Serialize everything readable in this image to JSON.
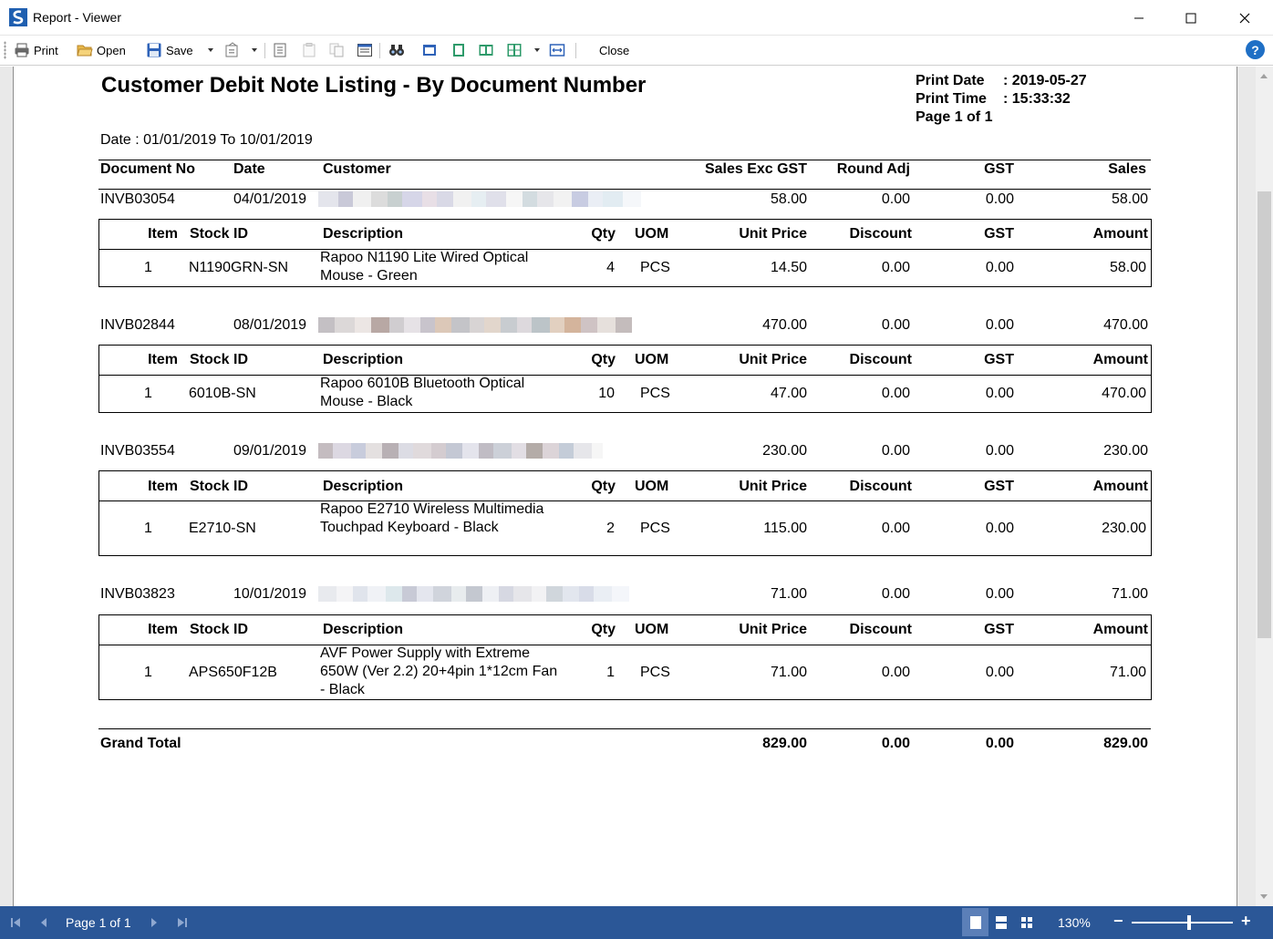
{
  "window": {
    "title": "Report - Viewer",
    "accent": "#2b5797"
  },
  "toolbar": {
    "print_label": "Print",
    "open_label": "Open",
    "save_label": "Save",
    "close_label": "Close",
    "help_label": "?"
  },
  "report": {
    "title": "Customer Debit Note Listing - By Document Number",
    "print_date_label": "Print Date",
    "print_date_value": ": 2019-05-27",
    "print_time_label": "Print Time",
    "print_time_value": ": 15:33:32",
    "page_label": "Page 1 of 1",
    "date_range": "Date : 01/01/2019 To 10/01/2019",
    "columns": {
      "doc_no": "Document No",
      "date": "Date",
      "customer": "Customer",
      "sales_exc_gst": "Sales Exc GST",
      "round_adj": "Round Adj",
      "gst": "GST",
      "sales": "Sales"
    },
    "detail_columns": {
      "item": "Item",
      "stock_id": "Stock ID",
      "description": "Description",
      "qty": "Qty",
      "uom": "UOM",
      "unit_price": "Unit Price",
      "discount": "Discount",
      "gst": "GST",
      "amount": "Amount"
    },
    "documents": [
      {
        "doc_no": "INVB03054",
        "date": "04/01/2019",
        "customer": "",
        "sales_exc_gst": "58.00",
        "round_adj": "0.00",
        "gst": "0.00",
        "sales": "58.00",
        "lines": [
          {
            "item": "1",
            "stock_id": "N1190GRN-SN",
            "description": "Rapoo N1190 Lite Wired Optical Mouse - Green",
            "qty": "4",
            "uom": "PCS",
            "unit_price": "14.50",
            "discount": "0.00",
            "gst": "0.00",
            "amount": "58.00"
          }
        ]
      },
      {
        "doc_no": "INVB02844",
        "date": "08/01/2019",
        "customer": "",
        "sales_exc_gst": "470.00",
        "round_adj": "0.00",
        "gst": "0.00",
        "sales": "470.00",
        "lines": [
          {
            "item": "1",
            "stock_id": "6010B-SN",
            "description": "Rapoo 6010B Bluetooth Optical Mouse - Black",
            "qty": "10",
            "uom": "PCS",
            "unit_price": "47.00",
            "discount": "0.00",
            "gst": "0.00",
            "amount": "470.00"
          }
        ]
      },
      {
        "doc_no": "INVB03554",
        "date": "09/01/2019",
        "customer": "",
        "sales_exc_gst": "230.00",
        "round_adj": "0.00",
        "gst": "0.00",
        "sales": "230.00",
        "lines": [
          {
            "item": "1",
            "stock_id": "E2710-SN",
            "description": "Rapoo E2710 Wireless Multimedia Touchpad Keyboard - Black",
            "qty": "2",
            "uom": "PCS",
            "unit_price": "115.00",
            "discount": "0.00",
            "gst": "0.00",
            "amount": "230.00"
          }
        ]
      },
      {
        "doc_no": "INVB03823",
        "date": "10/01/2019",
        "customer": "",
        "sales_exc_gst": "71.00",
        "round_adj": "0.00",
        "gst": "0.00",
        "sales": "71.00",
        "lines": [
          {
            "item": "1",
            "stock_id": "APS650F12B",
            "description": "AVF Power Supply with Extreme 650W (Ver 2.2) 20+4pin 1*12cm Fan - Black",
            "qty": "1",
            "uom": "PCS",
            "unit_price": "71.00",
            "discount": "0.00",
            "gst": "0.00",
            "amount": "71.00"
          }
        ]
      }
    ],
    "grand_total": {
      "label": "Grand Total",
      "sales_exc_gst": "829.00",
      "round_adj": "0.00",
      "gst": "0.00",
      "sales": "829.00"
    }
  },
  "statusbar": {
    "page_info": "Page 1 of 1",
    "zoom": "130%",
    "zoom_out": "−",
    "zoom_in": "+"
  }
}
